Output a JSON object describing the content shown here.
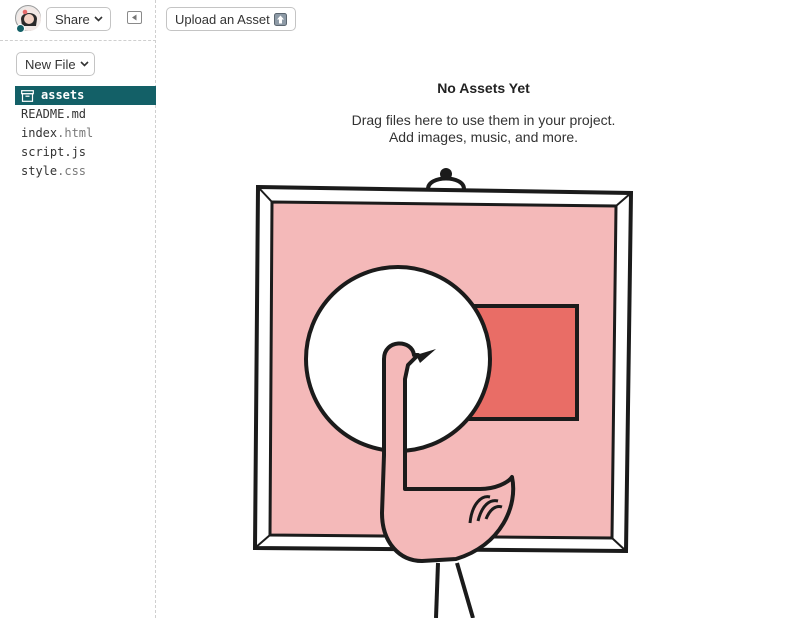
{
  "sidebar": {
    "share_label": "Share",
    "new_file_label": "New File",
    "files": [
      {
        "name": "assets",
        "ext": "",
        "active": true
      },
      {
        "name": "README",
        "ext": ".md",
        "active": false
      },
      {
        "name": "index",
        "ext": ".html",
        "active": false
      },
      {
        "name": "script",
        "ext": ".js",
        "active": false
      },
      {
        "name": "style",
        "ext": ".css",
        "active": false
      }
    ]
  },
  "toolbar": {
    "upload_label": "Upload an Asset"
  },
  "main": {
    "empty_title": "No Assets Yet",
    "empty_line1": "Drag files here to use them in your project.",
    "empty_line2": "Add images, music, and more."
  },
  "colors": {
    "accent": "#136067",
    "picture_pink": "#f4b9b9",
    "picture_red": "#e96d66",
    "ink": "#1b1b1b"
  }
}
